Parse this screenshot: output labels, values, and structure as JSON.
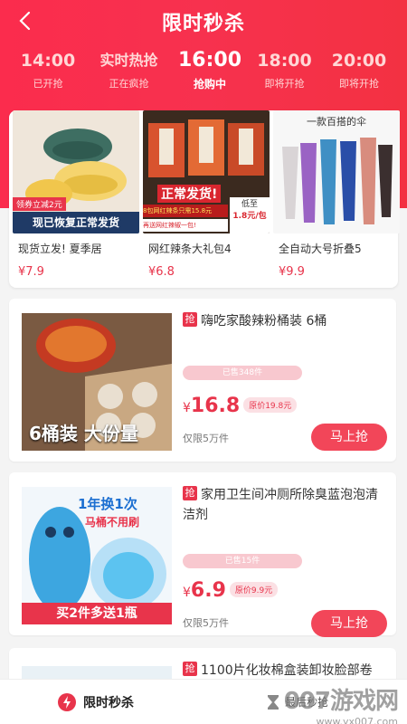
{
  "header": {
    "title": "限时秒杀",
    "time_slots": [
      {
        "time": "14:00",
        "status": "已开抢"
      },
      {
        "time": "实时热抢",
        "status": "正在疯抢"
      },
      {
        "time": "16:00",
        "status": "抢购中"
      },
      {
        "time": "18:00",
        "status": "即将开抢"
      },
      {
        "time": "20:00",
        "status": "即将开抢"
      }
    ]
  },
  "top_products": [
    {
      "name": "现货立发! 夏季居",
      "price": "¥7.9",
      "overlay_top": "领券立减2元",
      "overlay_bottom": "现已恢复正常发货"
    },
    {
      "name": "网红辣条大礼包4",
      "price": "¥6.8",
      "overlay_mid": "正常发货!",
      "overlay_red": "8包网红辣条只需15.8元",
      "overlay_low": "低至",
      "overlay_price": "1.8元/包",
      "overlay_small": "再送网红辣椒一包!"
    },
    {
      "name": "全自动大号折叠5",
      "price": "¥9.9",
      "overlay_top": "一款百搭的伞"
    }
  ],
  "products": [
    {
      "tag": "抢",
      "title": "嗨吃家酸辣粉桶装 6桶",
      "sold": "已售348件",
      "currency": "¥",
      "price": "16.8",
      "original": "原价19.8元",
      "limit": "仅限5万件",
      "buy_label": "马上抢",
      "image_text": "6桶装 大份量"
    },
    {
      "tag": "抢",
      "title": "家用卫生间冲厕所除臭蓝泡泡清洁剂",
      "sold": "已售15件",
      "currency": "¥",
      "price": "6.9",
      "original": "原价9.9元",
      "limit": "仅限5万件",
      "buy_label": "马上抢",
      "image_text_1": "1年换1次",
      "image_text_2": "马桶不用刷",
      "image_text_3": "买2件多送1瓶"
    },
    {
      "tag": "抢",
      "title": "1100片化妆棉盒装卸妆脸部卷",
      "extra": "最后秒抢"
    }
  ],
  "bottom_nav": {
    "tab1": "限时秒杀"
  },
  "watermark": {
    "line1": "007游戏网",
    "line2": "www.yx007.com"
  },
  "colors": {
    "accent": "#e8344b",
    "hero": "#f7314e",
    "button": "#f24659"
  }
}
